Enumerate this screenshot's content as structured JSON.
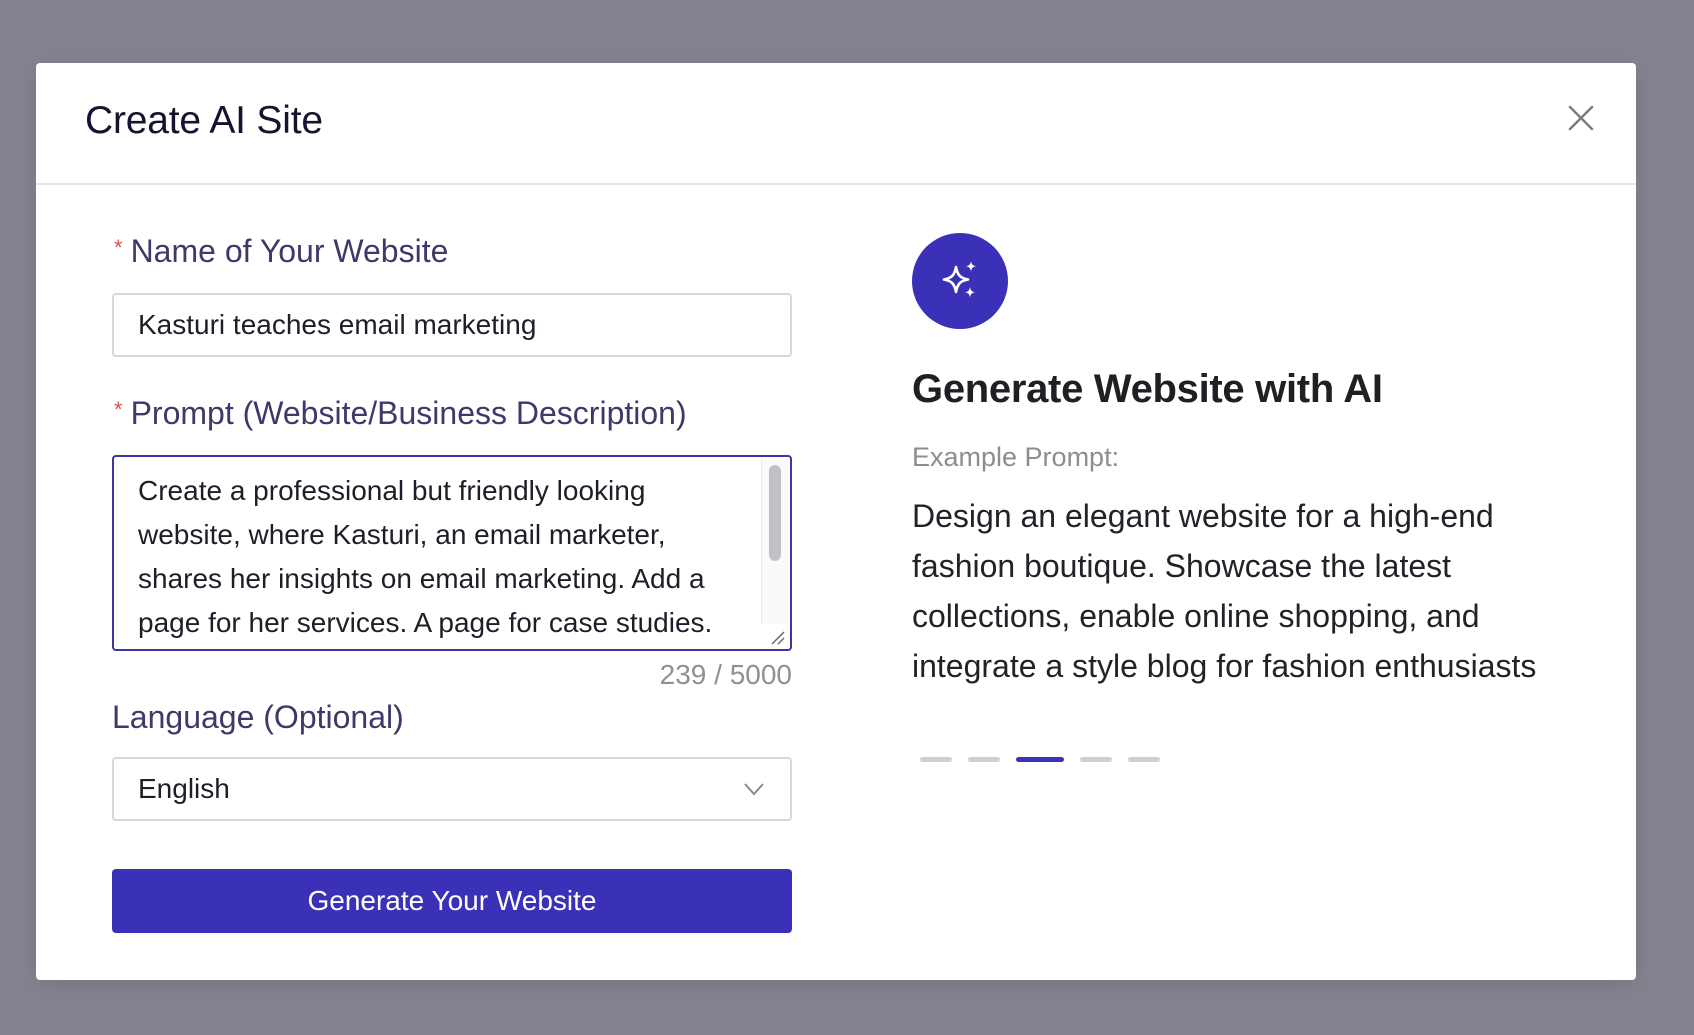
{
  "modal": {
    "title": "Create AI Site"
  },
  "form": {
    "name_label": "Name of Your Website",
    "name_value": "Kasturi teaches email marketing",
    "prompt_label": "Prompt (Website/Business Description)",
    "prompt_value": "Create a professional but friendly looking website, where Kasturi, an email marketer, shares her insights on email marketing. Add a page for her services. A page for case studies.",
    "counter": "239 / 5000",
    "language_label": "Language (Optional)",
    "language_value": "English",
    "submit_label": "Generate Your Website",
    "required_marker": "*"
  },
  "hero": {
    "title": "Generate Website with AI",
    "example_label": "Example Prompt:",
    "example_text": "Design an elegant website for a high-end fashion boutique. Showcase the latest collections, enable online shopping, and integrate a style blog for fashion enthusiasts",
    "icon": "sparkles-icon",
    "carousel": {
      "total": 5,
      "active_index": 2
    }
  },
  "colors": {
    "primary": "#3b31b8",
    "overlay": "#85838f",
    "required": "#d9534f",
    "label": "#3d3a6b"
  }
}
